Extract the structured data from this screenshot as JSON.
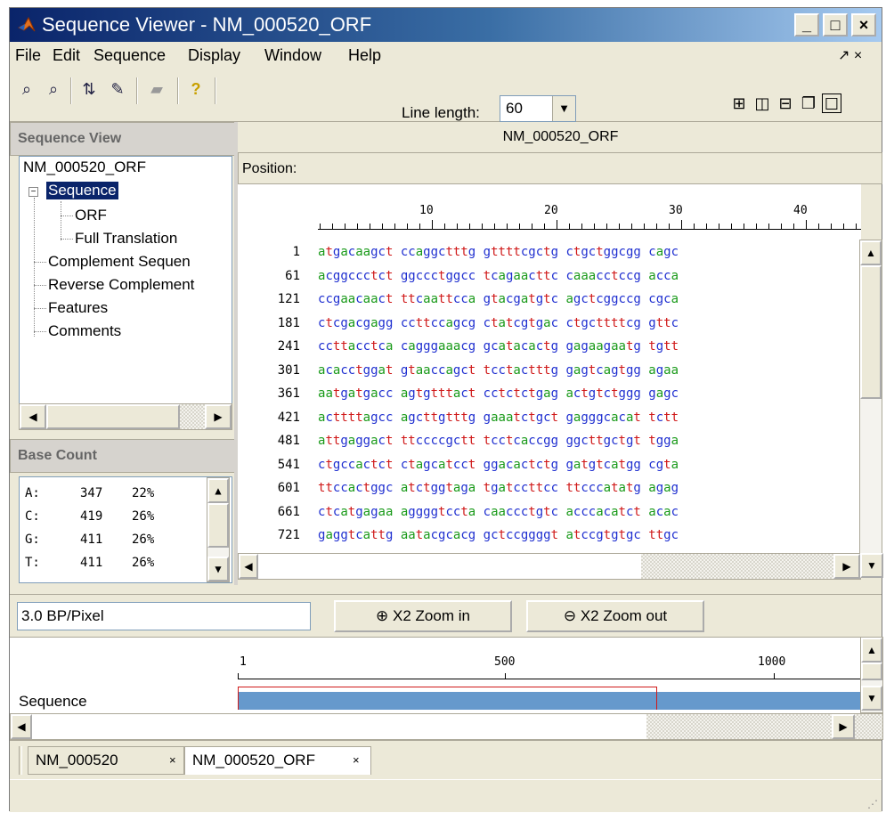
{
  "window": {
    "title": "Sequence Viewer - NM_000520_ORF"
  },
  "menu": [
    "File",
    "Edit",
    "Sequence",
    "Display",
    "Window",
    "Help"
  ],
  "menu_right": "↗ ×",
  "toolbar": {
    "line_length_label": "Line length:",
    "line_length_value": "60"
  },
  "sequence_view": {
    "header": "Sequence View",
    "tree": [
      "NM_000520_ORF",
      "Sequence",
      "ORF",
      "Full Translation",
      "Complement Sequen",
      "Reverse Complement",
      "Features",
      "Comments"
    ]
  },
  "base_count": {
    "header": "Base Count",
    "rows": [
      {
        "base": "A:",
        "count": "347",
        "pct": "22%"
      },
      {
        "base": "C:",
        "count": "419",
        "pct": "26%"
      },
      {
        "base": "G:",
        "count": "411",
        "pct": "26%"
      },
      {
        "base": "T:",
        "count": "411",
        "pct": "26%"
      }
    ]
  },
  "main": {
    "title": "NM_000520_ORF",
    "position_label": "Position:",
    "ruler": [
      "10",
      "20",
      "30",
      "40"
    ],
    "rows": [
      {
        "num": "1",
        "seq": "atgacaagct ccaggctttg gttttcgctg ctgctggcgg cagc"
      },
      {
        "num": "61",
        "seq": "acggccctct ggccctggcc tcagaacttc caaacctccg acca"
      },
      {
        "num": "121",
        "seq": "ccgaacaact ttcaattcca gtacgatgtc agctcggccg cgca"
      },
      {
        "num": "181",
        "seq": "ctcgacgagg ccttccagcg ctatcgtgac ctgcttttcg gttc"
      },
      {
        "num": "241",
        "seq": "ccttacctca cagggaaacg gcatacactg gagaagaatg tgtt"
      },
      {
        "num": "301",
        "seq": "acacctggat gtaaccagct tcctactttg gagtcagtgg agaa"
      },
      {
        "num": "361",
        "seq": "aatgatgacc agtgtttact cctctctgag actgtctggg gagc"
      },
      {
        "num": "421",
        "seq": "acttttagcc agcttgtttg gaaatctgct gagggcacat tctt"
      },
      {
        "num": "481",
        "seq": "attgaggact ttccccgctt tcctcaccgg ggcttgctgt tgga"
      },
      {
        "num": "541",
        "seq": "ctgccactct ctagcatcct ggacactctg gatgtcatgg cgta"
      },
      {
        "num": "601",
        "seq": "ttccactggc atctggtaga tgatccttcc ttcccatatg agag"
      },
      {
        "num": "661",
        "seq": "ctcatgagaa aggggtccta caaccctgtc acccacatct acac"
      },
      {
        "num": "721",
        "seq": "gaggtcattg aatacgcacg gctccggggt atccgtgtgc ttgc"
      }
    ]
  },
  "zoom": {
    "bp_per_pixel": "3.0 BP/Pixel",
    "zoom_in": "X2 Zoom in",
    "zoom_out": "X2 Zoom out"
  },
  "overview": {
    "ticks": [
      "1",
      "500",
      "1000"
    ],
    "track_label": "Sequence"
  },
  "tabs": [
    "NM_000520",
    "NM_000520_ORF"
  ]
}
